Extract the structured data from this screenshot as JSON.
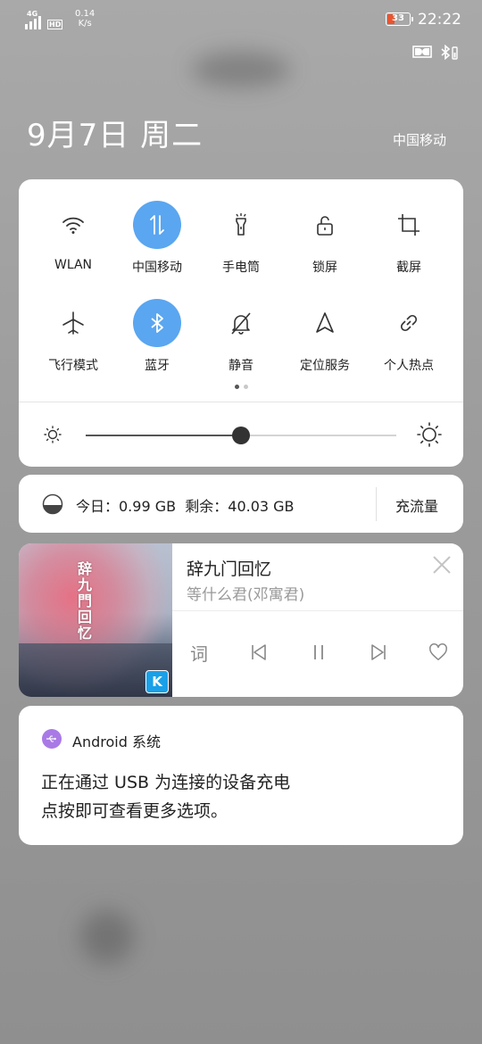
{
  "status_bar": {
    "network_type": "4G",
    "hd_label": "HD",
    "speed_value": "0.14",
    "speed_unit": "K/s",
    "battery_level": "33",
    "time": "22:22"
  },
  "header": {
    "date": "9月7日 周二",
    "carrier": "中国移动"
  },
  "quick_settings": {
    "tiles": [
      {
        "label": "WLAN",
        "icon": "wifi-icon",
        "active": false
      },
      {
        "label": "中国移动",
        "icon": "mobile-data-icon",
        "active": true
      },
      {
        "label": "手电筒",
        "icon": "flashlight-icon",
        "active": false
      },
      {
        "label": "锁屏",
        "icon": "lock-icon",
        "active": false
      },
      {
        "label": "截屏",
        "icon": "screenshot-icon",
        "active": false
      },
      {
        "label": "飞行模式",
        "icon": "airplane-icon",
        "active": false
      },
      {
        "label": "蓝牙",
        "icon": "bluetooth-icon",
        "active": true
      },
      {
        "label": "静音",
        "icon": "mute-icon",
        "active": false
      },
      {
        "label": "定位服务",
        "icon": "location-icon",
        "active": false
      },
      {
        "label": "个人热点",
        "icon": "hotspot-icon",
        "active": false
      }
    ],
    "page_count": 2,
    "current_page": 1,
    "brightness_level": 0.5,
    "active_color": "#5aa6f0"
  },
  "data_usage": {
    "text": "今日：0.99 GB  剩余：40.03 GB",
    "topup_label": "充流量"
  },
  "music": {
    "title": "辞九门回忆",
    "artist": "等什么君(邓寓君)",
    "art_text": "辞九門回忆",
    "app_badge": "K",
    "lyrics_label": "词"
  },
  "notification": {
    "app_name": "Android 系统",
    "line1": "正在通过 USB 为连接的设备充电",
    "line2": "点按即可查看更多选项。"
  }
}
